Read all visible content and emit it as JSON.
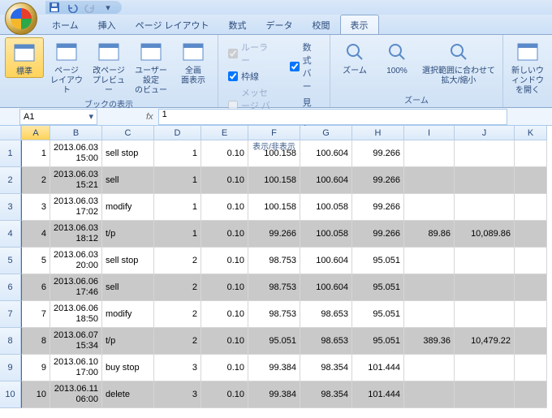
{
  "qat": {
    "save": "save-icon",
    "undo": "undo-icon",
    "redo": "redo-icon"
  },
  "tabs": [
    "ホーム",
    "挿入",
    "ページ レイアウト",
    "数式",
    "データ",
    "校閲",
    "表示"
  ],
  "active_tab": 6,
  "ribbon": {
    "group1": {
      "label": "ブックの表示",
      "buttons": [
        {
          "name": "normal-view",
          "label": "標準"
        },
        {
          "name": "page-layout",
          "label": "ページ\nレイアウト"
        },
        {
          "name": "page-break",
          "label": "改ページ\nプレビュー"
        },
        {
          "name": "custom-view",
          "label": "ユーザー設定\nのビュー"
        },
        {
          "name": "fullscreen",
          "label": "全画\n面表示"
        }
      ]
    },
    "group2": {
      "label": "表示/非表示",
      "checks_left": [
        {
          "label": "ルーラー",
          "checked": true,
          "disabled": true
        },
        {
          "label": "枠線",
          "checked": true,
          "disabled": false
        },
        {
          "label": "メッセージ バー",
          "checked": false,
          "disabled": true
        }
      ],
      "checks_right": [
        {
          "label": "数式バー",
          "checked": true
        },
        {
          "label": "見出し",
          "checked": true
        }
      ]
    },
    "group3": {
      "label": "ズーム",
      "buttons": [
        {
          "name": "zoom",
          "label": "ズーム"
        },
        {
          "name": "zoom100",
          "label": "100%"
        },
        {
          "name": "zoom-selection",
          "label": "選択範囲に合わせて\n拡大/縮小"
        }
      ]
    },
    "group4": {
      "buttons": [
        {
          "name": "new-window",
          "label": "新しいウィンドウ\nを開く"
        }
      ]
    }
  },
  "namebox": "A1",
  "formula": "1",
  "columns": [
    "A",
    "B",
    "C",
    "D",
    "E",
    "F",
    "G",
    "H",
    "I",
    "J",
    "K"
  ],
  "col_w": [
    "w-a",
    "w-b",
    "w-c",
    "w-d",
    "w-e",
    "w-f",
    "w-g",
    "w-h",
    "w-i",
    "w-j",
    "w-k"
  ],
  "rows": [
    {
      "n": 1,
      "stripe": false,
      "c": [
        "1",
        "2013.06.03 15:00",
        "sell stop",
        "1",
        "0.10",
        "100.158",
        "100.604",
        "99.266",
        "",
        ""
      ]
    },
    {
      "n": 2,
      "stripe": true,
      "c": [
        "2",
        "2013.06.03 15:21",
        "sell",
        "1",
        "0.10",
        "100.158",
        "100.604",
        "99.266",
        "",
        ""
      ]
    },
    {
      "n": 3,
      "stripe": false,
      "c": [
        "3",
        "2013.06.03 17:02",
        "modify",
        "1",
        "0.10",
        "100.158",
        "100.058",
        "99.266",
        "",
        ""
      ]
    },
    {
      "n": 4,
      "stripe": true,
      "c": [
        "4",
        "2013.06.03 18:12",
        "t/p",
        "1",
        "0.10",
        "99.266",
        "100.058",
        "99.266",
        "89.86",
        "10,089.86"
      ]
    },
    {
      "n": 5,
      "stripe": false,
      "c": [
        "5",
        "2013.06.03 20:00",
        "sell stop",
        "2",
        "0.10",
        "98.753",
        "100.604",
        "95.051",
        "",
        ""
      ]
    },
    {
      "n": 6,
      "stripe": true,
      "c": [
        "6",
        "2013.06.06 17:46",
        "sell",
        "2",
        "0.10",
        "98.753",
        "100.604",
        "95.051",
        "",
        ""
      ]
    },
    {
      "n": 7,
      "stripe": false,
      "c": [
        "7",
        "2013.06.06 18:50",
        "modify",
        "2",
        "0.10",
        "98.753",
        "98.653",
        "95.051",
        "",
        ""
      ]
    },
    {
      "n": 8,
      "stripe": true,
      "c": [
        "8",
        "2013.06.07 15:34",
        "t/p",
        "2",
        "0.10",
        "95.051",
        "98.653",
        "95.051",
        "389.36",
        "10,479.22"
      ]
    },
    {
      "n": 9,
      "stripe": false,
      "c": [
        "9",
        "2013.06.10 17:00",
        "buy stop",
        "3",
        "0.10",
        "99.384",
        "98.354",
        "101.444",
        "",
        ""
      ]
    },
    {
      "n": 10,
      "stripe": true,
      "c": [
        "10",
        "2013.06.11 06:00",
        "delete",
        "3",
        "0.10",
        "99.384",
        "98.354",
        "101.444",
        "",
        ""
      ]
    }
  ],
  "align": [
    "r",
    "r",
    "l",
    "r",
    "r",
    "r",
    "r",
    "r",
    "r",
    "r"
  ]
}
